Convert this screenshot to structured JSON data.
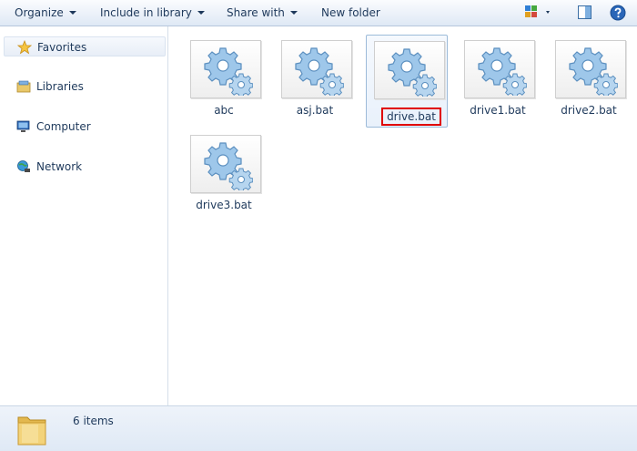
{
  "toolbar": {
    "organize": "Organize",
    "include_in_library": "Include in library",
    "share_with": "Share with",
    "new_folder": "New folder"
  },
  "nav": {
    "favorites": "Favorites",
    "libraries": "Libraries",
    "computer": "Computer",
    "network": "Network"
  },
  "files": [
    {
      "name": "abc"
    },
    {
      "name": "asj.bat"
    },
    {
      "name": "drive.bat"
    },
    {
      "name": "drive1.bat"
    },
    {
      "name": "drive2.bat"
    },
    {
      "name": "drive3.bat"
    }
  ],
  "status": {
    "item_count": "6 items"
  },
  "colors": {
    "rename_highlight": "#e00000",
    "selection_border": "#9dbbd9"
  }
}
